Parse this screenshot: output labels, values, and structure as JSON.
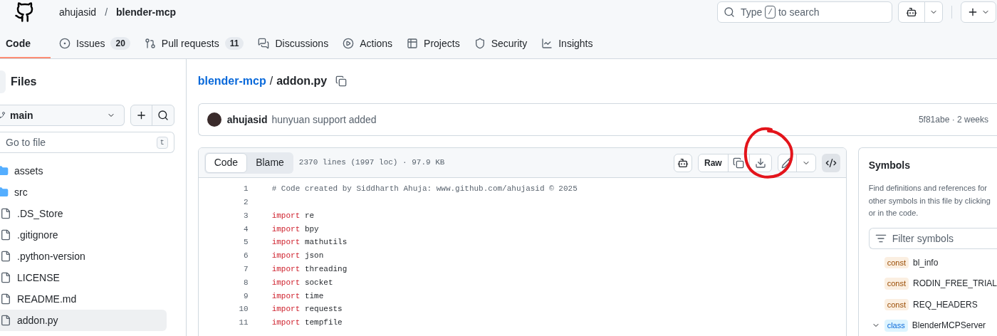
{
  "header": {
    "owner": "ahujasid",
    "separator": "/",
    "repo": "blender-mcp",
    "search": {
      "before": "Type",
      "key": "/",
      "after": "to search"
    }
  },
  "tabs": [
    {
      "label": "Code",
      "selected": true
    },
    {
      "label": "Issues",
      "count": "20",
      "selected": false
    },
    {
      "label": "Pull requests",
      "count": "11",
      "selected": false
    },
    {
      "label": "Discussions",
      "selected": false
    },
    {
      "label": "Actions",
      "selected": false
    },
    {
      "label": "Projects",
      "selected": false
    },
    {
      "label": "Security",
      "selected": false
    },
    {
      "label": "Insights",
      "selected": false
    }
  ],
  "sidebar": {
    "title": "Files",
    "branch": "main",
    "go_to_file": {
      "placeholder": "Go to file",
      "key": "t"
    },
    "items": [
      {
        "name": "assets",
        "kind": "folder",
        "selected": false
      },
      {
        "name": "src",
        "kind": "folder",
        "selected": false
      },
      {
        "name": ".DS_Store",
        "kind": "file",
        "selected": false
      },
      {
        "name": ".gitignore",
        "kind": "file",
        "selected": false
      },
      {
        "name": ".python-version",
        "kind": "file",
        "selected": false
      },
      {
        "name": "LICENSE",
        "kind": "file",
        "selected": false
      },
      {
        "name": "README.md",
        "kind": "file",
        "selected": false
      },
      {
        "name": "addon.py",
        "kind": "file",
        "selected": true
      }
    ]
  },
  "breadcrumb": {
    "repo": "blender-mcp",
    "separator": "/",
    "file": "addon.py"
  },
  "commit": {
    "author": "ahujasid",
    "message": "hunyuan support added",
    "meta": "5f81abe · 2 weeks"
  },
  "file_view": {
    "tabs": [
      {
        "label": "Code",
        "selected": true
      },
      {
        "label": "Blame",
        "selected": false
      }
    ],
    "info": "2370 lines (1997 loc) · 97.9 KB",
    "raw": "Raw",
    "lines": [
      {
        "number": "1",
        "kind": "comment",
        "text": "# Code created by Siddharth Ahuja: www.github.com/ahujasid © 2025"
      },
      {
        "number": "2",
        "kind": "blank"
      },
      {
        "number": "3",
        "kind": "import",
        "keyword": "import",
        "text": "re"
      },
      {
        "number": "4",
        "kind": "import",
        "keyword": "import",
        "text": "bpy"
      },
      {
        "number": "5",
        "kind": "import",
        "keyword": "import",
        "text": "mathutils"
      },
      {
        "number": "6",
        "kind": "import",
        "keyword": "import",
        "text": "json"
      },
      {
        "number": "7",
        "kind": "import",
        "keyword": "import",
        "text": "threading"
      },
      {
        "number": "8",
        "kind": "import",
        "keyword": "import",
        "text": "socket"
      },
      {
        "number": "9",
        "kind": "import",
        "keyword": "import",
        "text": "time"
      },
      {
        "number": "10",
        "kind": "import",
        "keyword": "import",
        "text": "requests"
      },
      {
        "number": "11",
        "kind": "import",
        "keyword": "import",
        "text": "tempfile"
      }
    ]
  },
  "symbols": {
    "title": "Symbols",
    "description": "Find definitions and references for other symbols in this file by clicking or in the code.",
    "filter": {
      "placeholder": "Filter symbols"
    },
    "items": [
      {
        "kind": "const",
        "name": "bl_info",
        "expanded": false
      },
      {
        "kind": "const",
        "name": "RODIN_FREE_TRIAL",
        "expanded": false
      },
      {
        "kind": "const",
        "name": "REQ_HEADERS",
        "expanded": false
      },
      {
        "kind": "class",
        "name": "BlenderMCPServer",
        "expanded": true
      }
    ]
  }
}
